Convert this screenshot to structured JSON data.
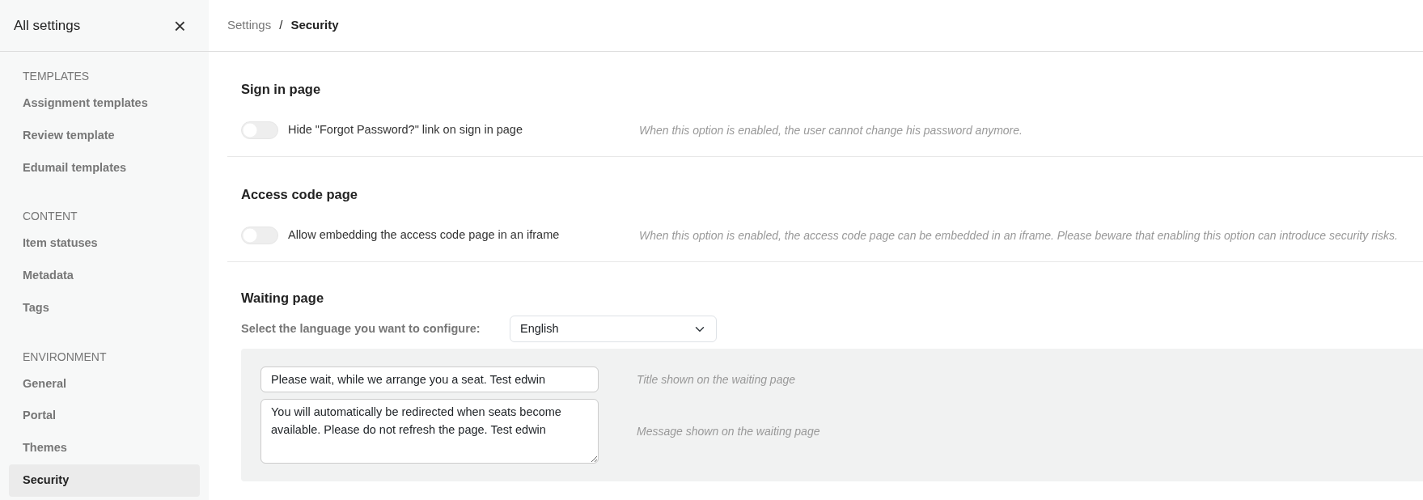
{
  "sidebar": {
    "title": "All settings",
    "close": "×",
    "groups": [
      {
        "heading": "TEMPLATES",
        "items": [
          {
            "label": "Assignment templates",
            "selected": false
          },
          {
            "label": "Review template",
            "selected": false
          },
          {
            "label": "Edumail templates",
            "selected": false
          }
        ]
      },
      {
        "heading": "CONTENT",
        "items": [
          {
            "label": "Item statuses",
            "selected": false
          },
          {
            "label": "Metadata",
            "selected": false
          },
          {
            "label": "Tags",
            "selected": false
          }
        ]
      },
      {
        "heading": "ENVIRONMENT",
        "items": [
          {
            "label": "General",
            "selected": false
          },
          {
            "label": "Portal",
            "selected": false
          },
          {
            "label": "Themes",
            "selected": false
          },
          {
            "label": "Security",
            "selected": true
          }
        ]
      }
    ]
  },
  "breadcrumb": [
    "Settings",
    "Security"
  ],
  "breadcrumb_separator": "/",
  "sections": [
    {
      "title": "Sign in page",
      "options": [
        {
          "label": "Hide \"Forgot Password?\" link on sign in page",
          "on": false,
          "help": "When this option is enabled, the user cannot change his password anymore."
        }
      ]
    },
    {
      "title": "Access code page",
      "options": [
        {
          "label": "Allow embedding the access code page in an iframe",
          "on": false,
          "help": "When this option is enabled, the access code page can be embedded in an iframe. Please beware that enabling this option can introduce security risks."
        }
      ]
    }
  ],
  "waiting_page": {
    "title": "Waiting page",
    "language_label": "Select the language you want to configure:",
    "language": "English",
    "fields": [
      {
        "kind": "input",
        "value": "Please wait, while we arrange you a seat. Test edwin",
        "help": "Title shown on the waiting page"
      },
      {
        "kind": "textarea",
        "value": "You will automatically be redirected when seats become available. Please do not refresh the page. Test edwin",
        "help": "Message shown on the waiting page"
      }
    ]
  }
}
